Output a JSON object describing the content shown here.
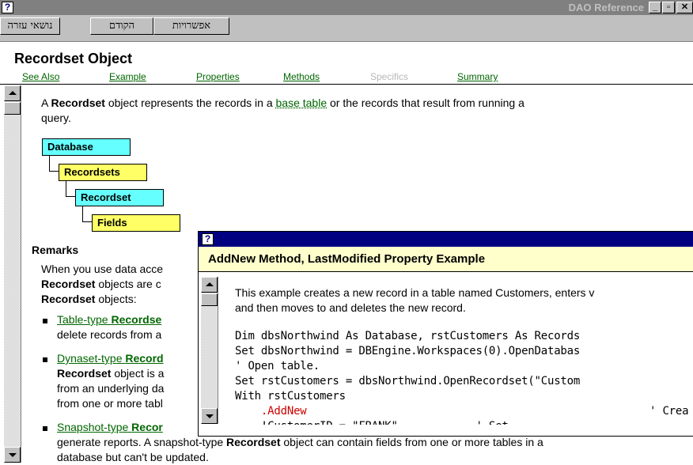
{
  "window": {
    "title": "DAO Reference",
    "icon_glyph": "?",
    "min_glyph": "_",
    "max_glyph": "▫",
    "close_glyph": "✕"
  },
  "toolbar": {
    "buttons": [
      {
        "label": "נושאי עזרה"
      },
      {
        "label": "הקודם"
      },
      {
        "label": "אפשרויות"
      }
    ]
  },
  "page": {
    "title": "Recordset Object",
    "nav": [
      {
        "label": "See Also",
        "enabled": true
      },
      {
        "label": "Example",
        "enabled": true
      },
      {
        "label": "Properties",
        "enabled": true
      },
      {
        "label": "Methods",
        "enabled": true
      },
      {
        "label": "Specifics",
        "enabled": false
      },
      {
        "label": "Summary",
        "enabled": true
      }
    ]
  },
  "intro": {
    "t1": "A ",
    "b1": "Recordset",
    "t2": " object represents the records in a ",
    "link": "base table",
    "t3": " or the records that result from running a",
    "t4": "query."
  },
  "hierarchy": [
    {
      "label": "Database",
      "color": "#66ffff"
    },
    {
      "label": "Recordsets",
      "color": "#ffff66"
    },
    {
      "label": "Recordset",
      "color": "#66ffff"
    },
    {
      "label": "Fields",
      "color": "#ffff66"
    }
  ],
  "remarks": {
    "heading": "Remarks",
    "line1": "When you use data acce",
    "line2_b": "Recordset",
    "line2_t": " objects are c",
    "line3_b": "Recordset",
    "line3_t": " objects:",
    "bullets": [
      {
        "link": "Table-type ",
        "link_b": "Recordse",
        "lines": [
          "delete records from a"
        ]
      },
      {
        "link": "Dynaset-type ",
        "link_b": "Record",
        "line_b": "Recordset",
        "line_t": " object is a",
        "lines": [
          "from an underlying da",
          "from one or more tabl"
        ]
      },
      {
        "link": "Snapshot-type ",
        "link_b": "Recor",
        "lines": []
      }
    ],
    "tail1_a": "generate reports. A snapshot-type ",
    "tail1_b": "Recordset",
    "tail1_c": " object can contain fields from one or more tables in a",
    "tail2": "database but can't be updated."
  },
  "popup": {
    "title": "AddNew Method, LastModified Property Example",
    "icon_glyph": "?",
    "desc1": "This example creates a new record in a table named Customers, enters v",
    "desc2": "and then moves to and deletes the new record.",
    "code": [
      "Dim dbsNorthwind As Database, rstCustomers As Records",
      "Set dbsNorthwind = DBEngine.Workspaces(0).OpenDatabas",
      "' Open table.",
      "Set rstCustomers = dbsNorthwind.OpenRecordset(\"Custom",
      "With rstCustomers"
    ],
    "addnew_indent": "    ",
    "addnew_keyword": ".AddNew",
    "addnew_comment": "' Crea",
    "partial_line": "    !CustomerID = \"FRANK\"            ' Set"
  }
}
